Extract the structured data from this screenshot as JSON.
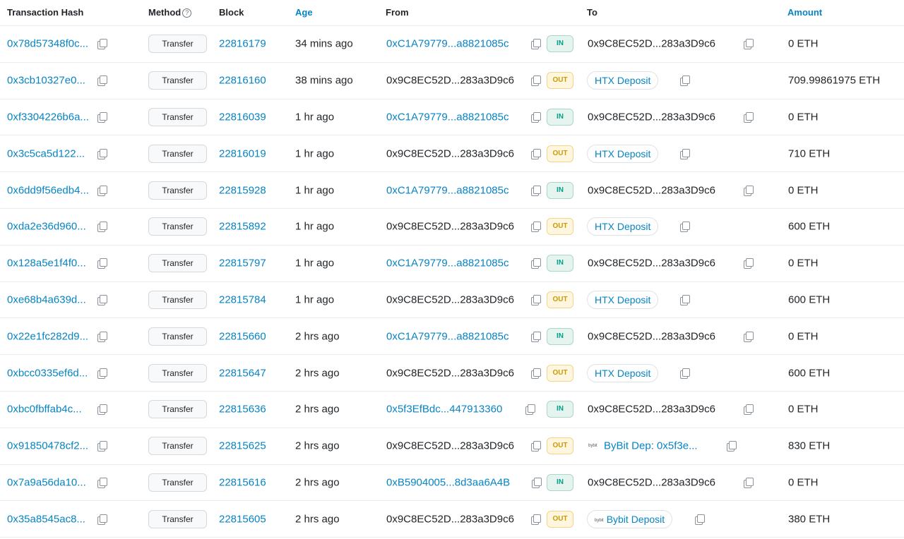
{
  "headers": {
    "hash": "Transaction Hash",
    "method": "Method",
    "method_help": "?",
    "block": "Block",
    "age": "Age",
    "from": "From",
    "to": "To",
    "amount": "Amount"
  },
  "rows": [
    {
      "hash": "0x78d57348f0c...",
      "method": "Transfer",
      "block": "22816179",
      "age": "34 mins ago",
      "from": "0xC1A79779...a8821085c",
      "from_link": true,
      "dir": "IN",
      "to": "0x9C8EC52D...283a3D9c6",
      "to_type": "plain",
      "to_mini": "",
      "amount": "0 ETH"
    },
    {
      "hash": "0x3cb10327e0...",
      "method": "Transfer",
      "block": "22816160",
      "age": "38 mins ago",
      "from": "0x9C8EC52D...283a3D9c6",
      "from_link": false,
      "dir": "OUT",
      "to": "HTX Deposit",
      "to_type": "pill",
      "to_mini": "",
      "amount": "709.99861975 ETH"
    },
    {
      "hash": "0xf3304226b6a...",
      "method": "Transfer",
      "block": "22816039",
      "age": "1 hr ago",
      "from": "0xC1A79779...a8821085c",
      "from_link": true,
      "dir": "IN",
      "to": "0x9C8EC52D...283a3D9c6",
      "to_type": "plain",
      "to_mini": "",
      "amount": "0 ETH"
    },
    {
      "hash": "0x3c5ca5d122...",
      "method": "Transfer",
      "block": "22816019",
      "age": "1 hr ago",
      "from": "0x9C8EC52D...283a3D9c6",
      "from_link": false,
      "dir": "OUT",
      "to": "HTX Deposit",
      "to_type": "pill",
      "to_mini": "",
      "amount": "710 ETH"
    },
    {
      "hash": "0x6dd9f56edb4...",
      "method": "Transfer",
      "block": "22815928",
      "age": "1 hr ago",
      "from": "0xC1A79779...a8821085c",
      "from_link": true,
      "dir": "IN",
      "to": "0x9C8EC52D...283a3D9c6",
      "to_type": "plain",
      "to_mini": "",
      "amount": "0 ETH"
    },
    {
      "hash": "0xda2e36d960...",
      "method": "Transfer",
      "block": "22815892",
      "age": "1 hr ago",
      "from": "0x9C8EC52D...283a3D9c6",
      "from_link": false,
      "dir": "OUT",
      "to": "HTX Deposit",
      "to_type": "pill",
      "to_mini": "",
      "amount": "600 ETH"
    },
    {
      "hash": "0x128a5e1f4f0...",
      "method": "Transfer",
      "block": "22815797",
      "age": "1 hr ago",
      "from": "0xC1A79779...a8821085c",
      "from_link": true,
      "dir": "IN",
      "to": "0x9C8EC52D...283a3D9c6",
      "to_type": "plain",
      "to_mini": "",
      "amount": "0 ETH"
    },
    {
      "hash": "0xe68b4a639d...",
      "method": "Transfer",
      "block": "22815784",
      "age": "1 hr ago",
      "from": "0x9C8EC52D...283a3D9c6",
      "from_link": false,
      "dir": "OUT",
      "to": "HTX Deposit",
      "to_type": "pill",
      "to_mini": "",
      "amount": "600 ETH"
    },
    {
      "hash": "0x22e1fc282d9...",
      "method": "Transfer",
      "block": "22815660",
      "age": "2 hrs ago",
      "from": "0xC1A79779...a8821085c",
      "from_link": true,
      "dir": "IN",
      "to": "0x9C8EC52D...283a3D9c6",
      "to_type": "plain",
      "to_mini": "",
      "amount": "0 ETH"
    },
    {
      "hash": "0xbcc0335ef6d...",
      "method": "Transfer",
      "block": "22815647",
      "age": "2 hrs ago",
      "from": "0x9C8EC52D...283a3D9c6",
      "from_link": false,
      "dir": "OUT",
      "to": "HTX Deposit",
      "to_type": "pill",
      "to_mini": "",
      "amount": "600 ETH"
    },
    {
      "hash": "0xbc0fbffab4c...",
      "method": "Transfer",
      "block": "22815636",
      "age": "2 hrs ago",
      "from": "0x5f3EfBdc...447913360",
      "from_link": true,
      "dir": "IN",
      "to": "0x9C8EC52D...283a3D9c6",
      "to_type": "plain",
      "to_mini": "",
      "amount": "0 ETH"
    },
    {
      "hash": "0x91850478cf2...",
      "method": "Transfer",
      "block": "22815625",
      "age": "2 hrs ago",
      "from": "0x9C8EC52D...283a3D9c6",
      "from_link": false,
      "dir": "OUT",
      "to": "ByBit Dep: 0x5f3e...",
      "to_type": "link",
      "to_mini": "bybit",
      "amount": "830 ETH"
    },
    {
      "hash": "0x7a9a56da10...",
      "method": "Transfer",
      "block": "22815616",
      "age": "2 hrs ago",
      "from": "0xB5904005...8d3aa6A4B",
      "from_link": true,
      "dir": "IN",
      "to": "0x9C8EC52D...283a3D9c6",
      "to_type": "plain",
      "to_mini": "",
      "amount": "0 ETH"
    },
    {
      "hash": "0x35a8545ac8...",
      "method": "Transfer",
      "block": "22815605",
      "age": "2 hrs ago",
      "from": "0x9C8EC52D...283a3D9c6",
      "from_link": false,
      "dir": "OUT",
      "to": "Bybit Deposit",
      "to_type": "pill",
      "to_mini": "bybit",
      "amount": "380 ETH"
    }
  ],
  "colors": {
    "link": "#0784c3",
    "in": "#00a186",
    "out": "#cc9a06"
  }
}
